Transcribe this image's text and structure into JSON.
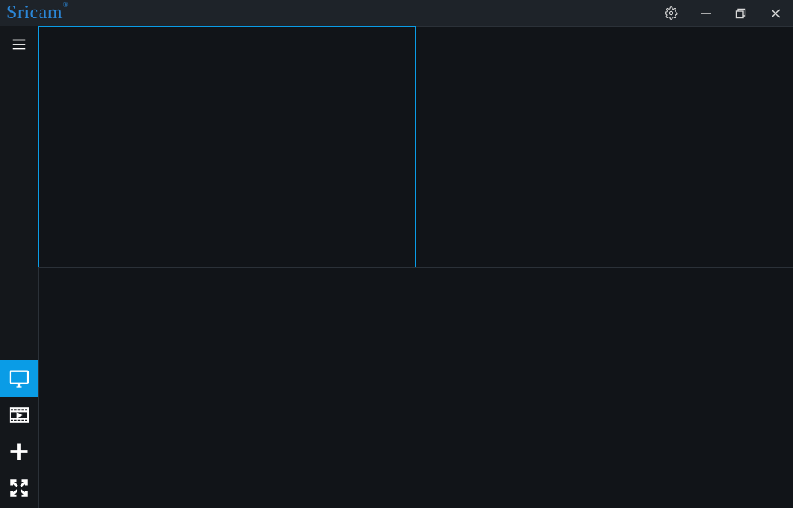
{
  "app": {
    "name": "Sricam",
    "trademark": "®"
  },
  "titlebar": {
    "settings_icon": "settings",
    "minimize_icon": "minimize",
    "maximize_icon": "maximize-restore",
    "close_icon": "close"
  },
  "sidebar": {
    "menu_icon": "hamburger",
    "items": [
      {
        "id": "live-view",
        "icon": "monitor",
        "active": true
      },
      {
        "id": "playback",
        "icon": "film-play",
        "active": false
      },
      {
        "id": "add-device",
        "icon": "plus",
        "active": false
      },
      {
        "id": "fullscreen",
        "icon": "expand",
        "active": false
      }
    ]
  },
  "grid": {
    "layout": "2x2",
    "panes": [
      {
        "index": 1,
        "selected": true
      },
      {
        "index": 2,
        "selected": false
      },
      {
        "index": 3,
        "selected": false
      },
      {
        "index": 4,
        "selected": false
      }
    ]
  }
}
